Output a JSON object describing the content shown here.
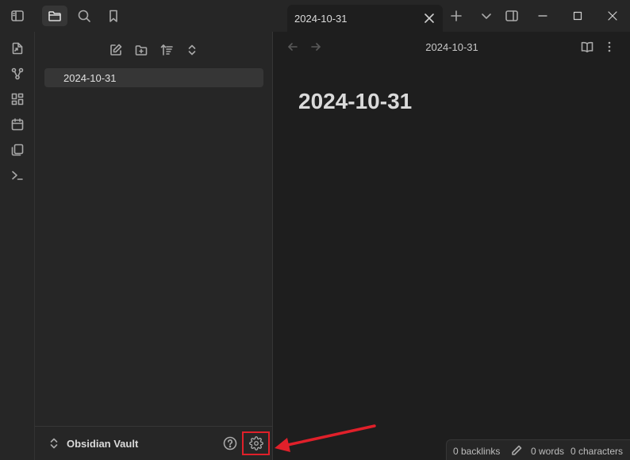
{
  "tab": {
    "title": "2024-10-31"
  },
  "explorer": {
    "files": [
      "2024-10-31"
    ],
    "vault_name": "Obsidian Vault"
  },
  "editor": {
    "header_title": "2024-10-31",
    "note_title": "2024-10-31"
  },
  "status": {
    "backlinks": "0 backlinks",
    "words": "0 words",
    "characters": "0 characters"
  },
  "colors": {
    "background": "#1e1e1e",
    "panel": "#262626",
    "highlight": "#e0202a"
  },
  "icons": {
    "titlebar": [
      "sidebar-toggle-icon",
      "folder-icon",
      "search-icon",
      "bookmark-icon"
    ],
    "ribbon": [
      "open-quick-switcher-icon",
      "graph-view-icon",
      "canvas-icon",
      "calendar-icon",
      "templates-icon",
      "command-palette-icon"
    ],
    "explorer_nav": [
      "new-note-icon",
      "new-folder-icon",
      "sort-icon",
      "collapse-icon"
    ]
  }
}
